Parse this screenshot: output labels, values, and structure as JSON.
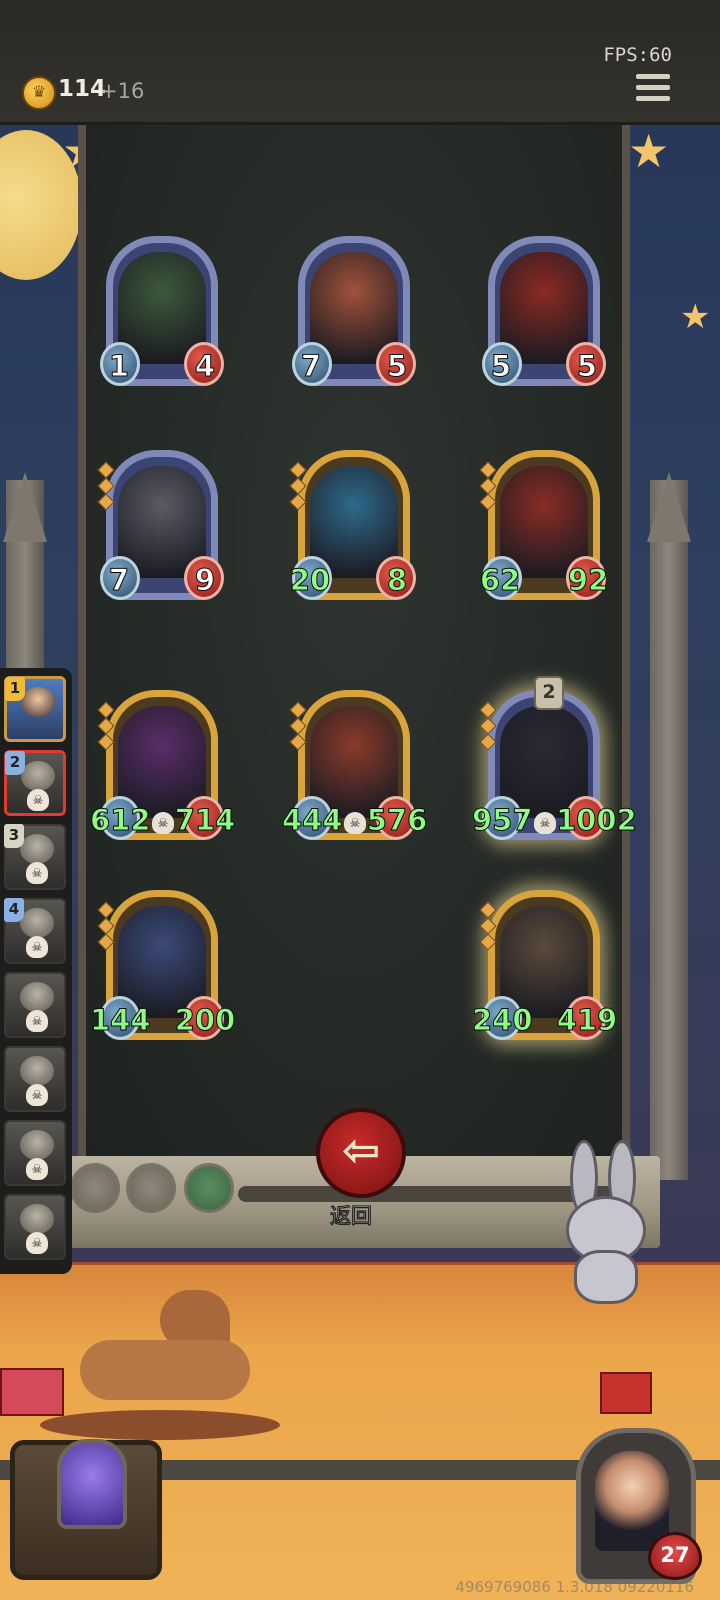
{
  "hud": {
    "gold": "114",
    "gold_income": "+16",
    "fps": "FPS:60",
    "menu_icon": "hamburger-menu-icon"
  },
  "board": {
    "minions": [
      {
        "attack": "1",
        "health": "4",
        "frame": "blue",
        "stat_color": "white"
      },
      {
        "attack": "7",
        "health": "5",
        "frame": "blue",
        "stat_color": "white"
      },
      {
        "attack": "5",
        "health": "5",
        "frame": "blue",
        "stat_color": "white"
      },
      {
        "attack": "7",
        "health": "9",
        "frame": "blue",
        "stat_color": "white"
      },
      {
        "attack": "20",
        "health": "8",
        "frame": "gold",
        "stat_color": "green"
      },
      {
        "attack": "62",
        "health": "92",
        "frame": "gold",
        "stat_color": "green"
      },
      {
        "attack": "612",
        "health": "714",
        "frame": "gold",
        "stat_color": "green"
      },
      {
        "attack": "444",
        "health": "576",
        "frame": "gold",
        "stat_color": "green"
      },
      {
        "attack": "957",
        "health": "1002",
        "frame": "blue",
        "stat_color": "green",
        "tier": "2"
      },
      {
        "attack": "144",
        "health": "200",
        "frame": "gold",
        "stat_color": "green"
      },
      {
        "attack": "240",
        "health": "419",
        "frame": "gold",
        "stat_color": "green"
      }
    ]
  },
  "leaderboard": {
    "players": [
      {
        "rank": "1",
        "rank_color": "gold",
        "state": "current"
      },
      {
        "rank": "2",
        "rank_color": "blue",
        "state": "highlighted"
      },
      {
        "rank": "3",
        "rank_color": "silver",
        "state": "normal"
      },
      {
        "rank": "4",
        "rank_color": "blue",
        "state": "normal"
      },
      {
        "rank": "",
        "rank_color": "",
        "state": "normal"
      },
      {
        "rank": "",
        "rank_color": "",
        "state": "normal"
      },
      {
        "rank": "",
        "rank_color": "",
        "state": "normal"
      },
      {
        "rank": "",
        "rank_color": "",
        "state": "normal"
      }
    ]
  },
  "back_button": {
    "icon": "arrow-left-icon",
    "label": "返回"
  },
  "hero": {
    "health": "27"
  },
  "footer": {
    "build_id": "4969769086 1.3.018 09220116"
  },
  "colors": {
    "stat_green": "#8cff83",
    "back_button_red": "#c82a2a",
    "gold_frame": "#d9a43c",
    "blue_frame": "#7f8ab8"
  }
}
